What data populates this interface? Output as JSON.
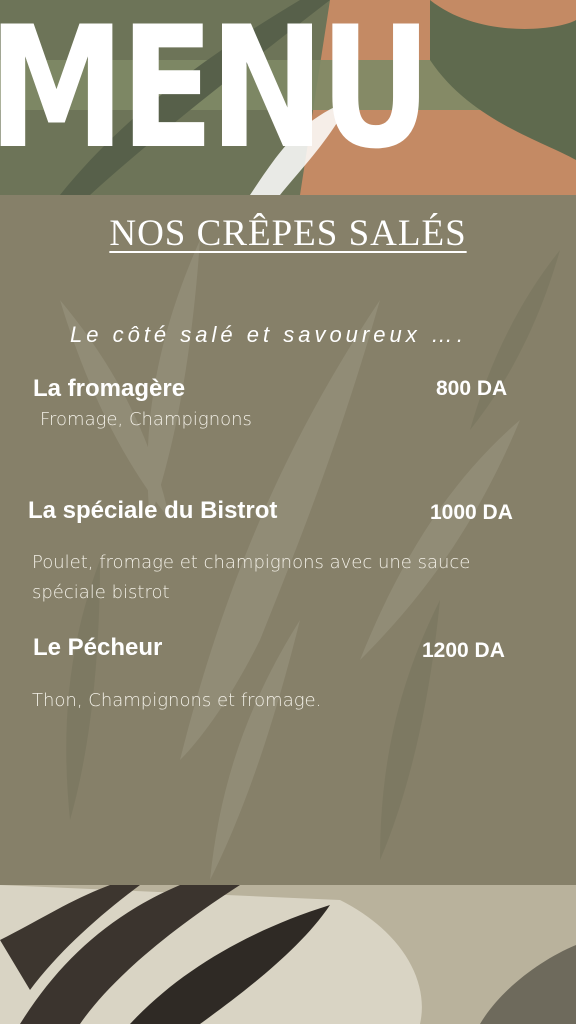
{
  "header": {
    "title": "MENU"
  },
  "section": {
    "title": "NOS CRÊPES SALÉS",
    "tagline": "Le côté salé et savoureux …."
  },
  "items": [
    {
      "name": "La fromagère",
      "price": "800 DA",
      "description": "Fromage, Champignons"
    },
    {
      "name": "La spéciale du Bistrot",
      "price": "1000 DA",
      "description": "Poulet, fromage et champignons  avec une sauce spéciale bistrot"
    },
    {
      "name": "Le Pécheur",
      "price": "1200 DA",
      "description": "Thon, Champignons et fromage."
    }
  ],
  "colors": {
    "panel": "#858068",
    "leaf_dark": "#5f6a4e",
    "leaf_light": "#a9a590",
    "terracotta": "#c48a64",
    "text": "#ffffff"
  }
}
